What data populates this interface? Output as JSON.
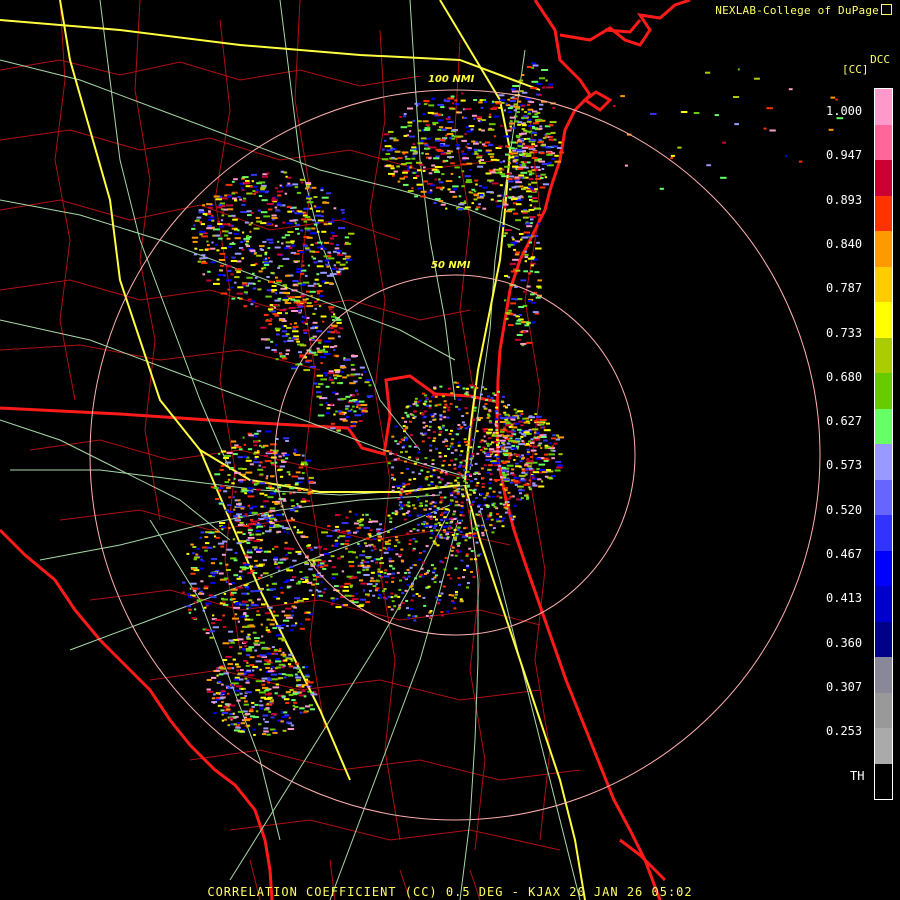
{
  "header": {
    "credit": "NEXLAB-College of DuPage",
    "product_code": "DCC",
    "unit": "[CC]"
  },
  "range_rings": [
    {
      "label": "50 NMI"
    },
    {
      "label": "100 NMI"
    }
  ],
  "legend": {
    "ticks": [
      "1.000",
      "0.947",
      "0.893",
      "0.840",
      "0.787",
      "0.733",
      "0.680",
      "0.627",
      "0.573",
      "0.520",
      "0.467",
      "0.413",
      "0.360",
      "0.307",
      "0.253",
      "TH"
    ],
    "colors": [
      "#ff99cc",
      "#ff6699",
      "#cc0033",
      "#ff3300",
      "#ff9900",
      "#ffcc00",
      "#ffff00",
      "#aacc00",
      "#66cc00",
      "#66ff66",
      "#9999ff",
      "#6666ff",
      "#3333ff",
      "#0000ff",
      "#0000cc",
      "#000088",
      "#888899",
      "#999999",
      "#aaaaaa",
      "#000000"
    ]
  },
  "footer": "CORRELATION COEFFICIENT (CC) 0.5 DEG - KJAX 20 JAN 26 05:02",
  "colors": {
    "state_border": "#ff1a1a",
    "county_border": "#b01010",
    "roads": "#a8d8a8",
    "interstates": "#ffff40",
    "range_ring": "#ffb0b0",
    "text": "#ffff66"
  }
}
